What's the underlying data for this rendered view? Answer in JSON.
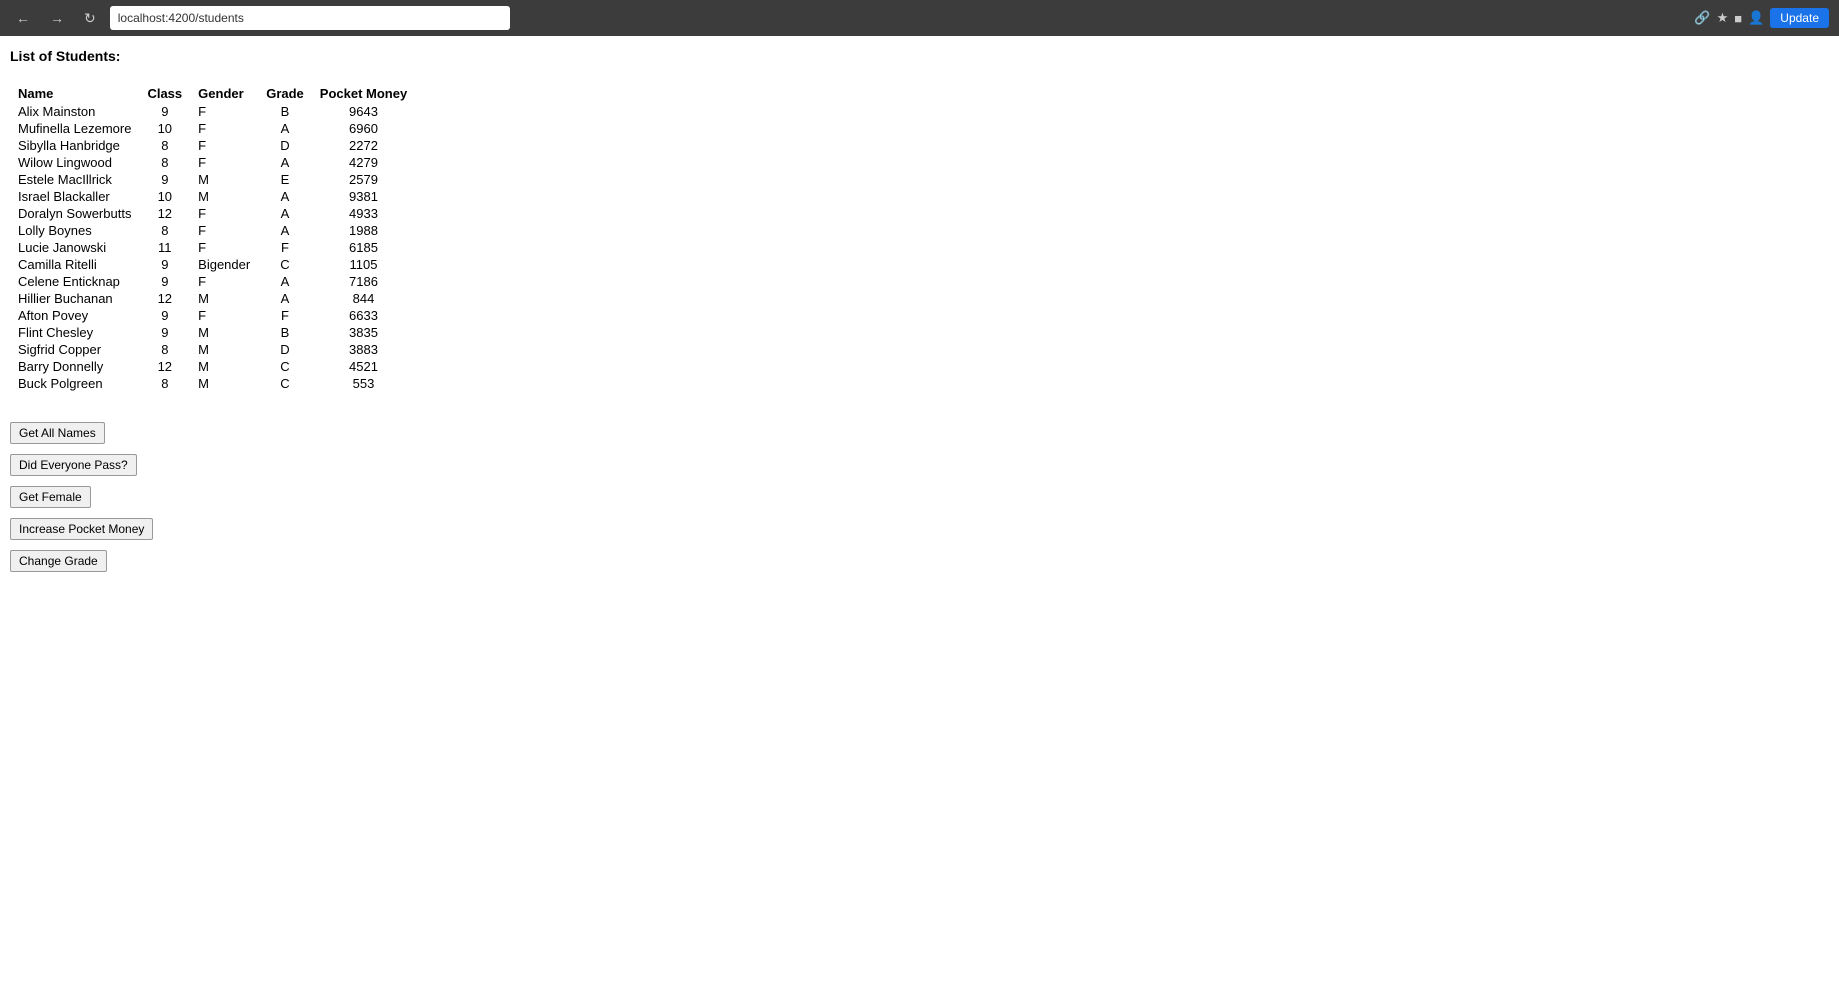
{
  "browser": {
    "url": "localhost:4200/students",
    "update_label": "Update"
  },
  "page": {
    "title": "List of Students:"
  },
  "table": {
    "headers": [
      "Name",
      "Class",
      "Gender",
      "Grade",
      "Pocket Money"
    ],
    "rows": [
      {
        "name": "Alix Mainston",
        "class": "9",
        "gender": "F",
        "grade": "B",
        "pocket_money": "9643"
      },
      {
        "name": "Mufinella Lezemore",
        "class": "10",
        "gender": "F",
        "grade": "A",
        "pocket_money": "6960"
      },
      {
        "name": "Sibylla Hanbridge",
        "class": "8",
        "gender": "F",
        "grade": "D",
        "pocket_money": "2272"
      },
      {
        "name": "Wilow Lingwood",
        "class": "8",
        "gender": "F",
        "grade": "A",
        "pocket_money": "4279"
      },
      {
        "name": "Estele MacIllrick",
        "class": "9",
        "gender": "M",
        "grade": "E",
        "pocket_money": "2579"
      },
      {
        "name": "Israel Blackaller",
        "class": "10",
        "gender": "M",
        "grade": "A",
        "pocket_money": "9381"
      },
      {
        "name": "Doralyn Sowerbutts",
        "class": "12",
        "gender": "F",
        "grade": "A",
        "pocket_money": "4933"
      },
      {
        "name": "Lolly Boynes",
        "class": "8",
        "gender": "F",
        "grade": "A",
        "pocket_money": "1988"
      },
      {
        "name": "Lucie Janowski",
        "class": "11",
        "gender": "F",
        "grade": "F",
        "pocket_money": "6185"
      },
      {
        "name": "Camilla Ritelli",
        "class": "9",
        "gender": "Bigender",
        "grade": "C",
        "pocket_money": "1105"
      },
      {
        "name": "Celene Enticknap",
        "class": "9",
        "gender": "F",
        "grade": "A",
        "pocket_money": "7186"
      },
      {
        "name": "Hillier Buchanan",
        "class": "12",
        "gender": "M",
        "grade": "A",
        "pocket_money": "844"
      },
      {
        "name": "Afton Povey",
        "class": "9",
        "gender": "F",
        "grade": "F",
        "pocket_money": "6633"
      },
      {
        "name": "Flint Chesley",
        "class": "9",
        "gender": "M",
        "grade": "B",
        "pocket_money": "3835"
      },
      {
        "name": "Sigfrid Copper",
        "class": "8",
        "gender": "M",
        "grade": "D",
        "pocket_money": "3883"
      },
      {
        "name": "Barry Donnelly",
        "class": "12",
        "gender": "M",
        "grade": "C",
        "pocket_money": "4521"
      },
      {
        "name": "Buck Polgreen",
        "class": "8",
        "gender": "M",
        "grade": "C",
        "pocket_money": "553"
      }
    ]
  },
  "buttons": {
    "get_all_names": "Get All Names",
    "did_everyone_pass": "Did Everyone Pass?",
    "get_female": "Get Female",
    "increase_pocket_money": "Increase Pocket Money",
    "change_grade": "Change Grade"
  }
}
